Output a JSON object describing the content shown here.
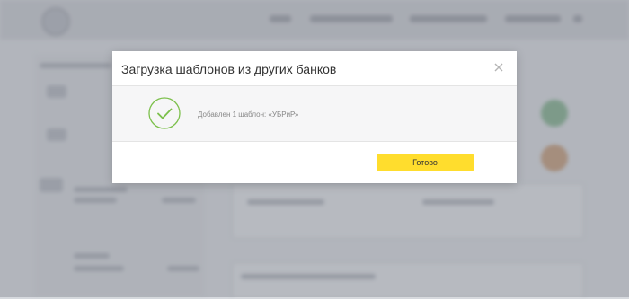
{
  "dialog": {
    "title": "Загрузка шаблонов из других банков",
    "close_icon": "close-icon",
    "result_icon": "checkmark-circle-icon",
    "result_message": "Добавлен 1 шаблон: «УБРиР»",
    "done_label": "Готово"
  },
  "colors": {
    "accent_button": "#ffdd2d",
    "success_icon": "#7cc04b"
  }
}
